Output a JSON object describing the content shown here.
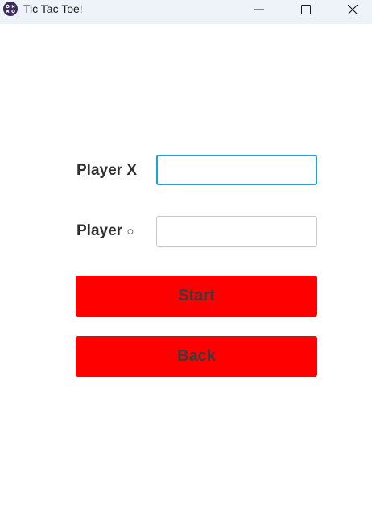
{
  "window": {
    "title": "Tic Tac Toe!",
    "app_icon": "tic-tac-toe-grid-icon",
    "controls": [
      "minimize-icon",
      "maximize-icon",
      "close-icon"
    ]
  },
  "form": {
    "player_x_label": "Player X",
    "player_o_label_prefix": "Player ",
    "player_o_label_mark": "○",
    "player_x_value": "",
    "player_o_value": ""
  },
  "buttons": {
    "start_label": "Start",
    "back_label": "Back"
  },
  "colors": {
    "button_background": "#ff0000",
    "button_text": "#3b3b3b",
    "focused_input_border": "#1aa3e0",
    "titlebar_background": "#eef3f9"
  }
}
